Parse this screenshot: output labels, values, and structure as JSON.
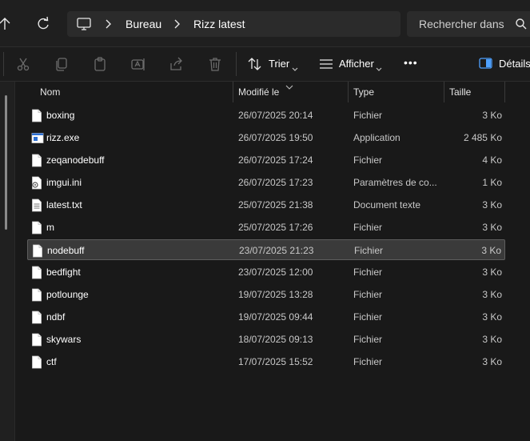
{
  "address": {
    "crumbs": [
      "Bureau",
      "Rizz latest"
    ]
  },
  "search": {
    "placeholder": "Rechercher dans"
  },
  "toolbar": {
    "sort_label": "Trier",
    "view_label": "Afficher",
    "details_label": "Détails",
    "more_label": "•••"
  },
  "columns": {
    "name": "Nom",
    "modified": "Modifié le",
    "type": "Type",
    "size": "Taille"
  },
  "files": [
    {
      "name": "boxing",
      "modified": "26/07/2025 20:14",
      "type": "Fichier",
      "size": "3 Ko",
      "icon": "file-icon"
    },
    {
      "name": "rizz.exe",
      "modified": "26/07/2025 19:50",
      "type": "Application",
      "size": "2 485 Ko",
      "icon": "application-icon"
    },
    {
      "name": "zeqanodebuff",
      "modified": "26/07/2025 17:24",
      "type": "Fichier",
      "size": "4 Ko",
      "icon": "file-icon"
    },
    {
      "name": "imgui.ini",
      "modified": "26/07/2025 17:23",
      "type": "Paramètres de co...",
      "size": "1 Ko",
      "icon": "settings-file-icon"
    },
    {
      "name": "latest.txt",
      "modified": "25/07/2025 21:38",
      "type": "Document texte",
      "size": "3 Ko",
      "icon": "text-file-icon"
    },
    {
      "name": "m",
      "modified": "25/07/2025 17:26",
      "type": "Fichier",
      "size": "3 Ko",
      "icon": "file-icon"
    },
    {
      "name": "nodebuff",
      "modified": "23/07/2025 21:23",
      "type": "Fichier",
      "size": "3 Ko",
      "icon": "file-icon",
      "selected": true
    },
    {
      "name": "bedfight",
      "modified": "23/07/2025 12:00",
      "type": "Fichier",
      "size": "3 Ko",
      "icon": "file-icon"
    },
    {
      "name": "potlounge",
      "modified": "19/07/2025 13:28",
      "type": "Fichier",
      "size": "3 Ko",
      "icon": "file-icon"
    },
    {
      "name": "ndbf",
      "modified": "19/07/2025 09:44",
      "type": "Fichier",
      "size": "3 Ko",
      "icon": "file-icon"
    },
    {
      "name": "skywars",
      "modified": "18/07/2025 09:13",
      "type": "Fichier",
      "size": "3 Ko",
      "icon": "file-icon"
    },
    {
      "name": "ctf",
      "modified": "17/07/2025 15:52",
      "type": "Fichier",
      "size": "3 Ko",
      "icon": "file-icon"
    }
  ],
  "colors": {
    "background": "#191919",
    "selected_row": "#3a3a3a",
    "accent_icon": "#4ea1ff"
  }
}
